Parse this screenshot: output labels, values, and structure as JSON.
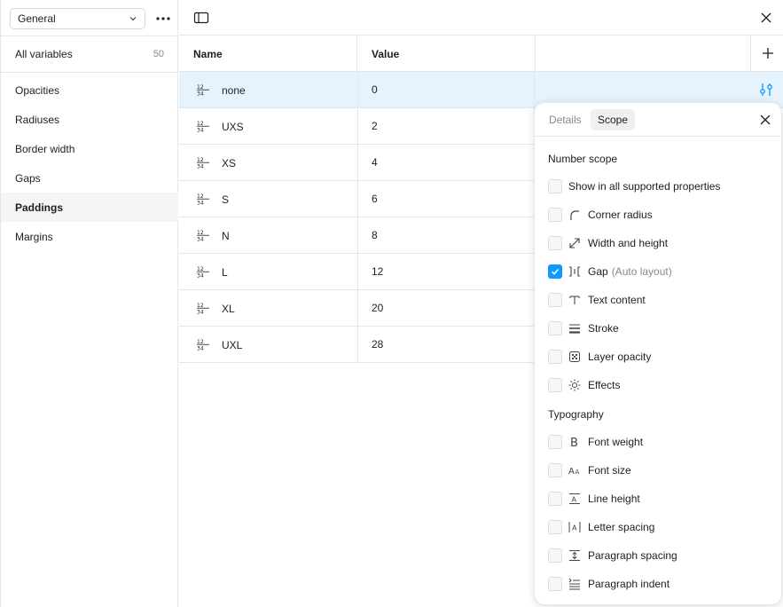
{
  "sidebar": {
    "collection": "General",
    "all_variables": {
      "label": "All variables",
      "count": "50"
    },
    "groups": [
      {
        "label": "Opacities",
        "active": false
      },
      {
        "label": "Radiuses",
        "active": false
      },
      {
        "label": "Border width",
        "active": false
      },
      {
        "label": "Gaps",
        "active": false
      },
      {
        "label": "Paddings",
        "active": true
      },
      {
        "label": "Margins",
        "active": false
      }
    ]
  },
  "table": {
    "headers": {
      "name": "Name",
      "value": "Value"
    },
    "rows": [
      {
        "name": "none",
        "value": "0",
        "selected": true
      },
      {
        "name": "UXS",
        "value": "2"
      },
      {
        "name": "XS",
        "value": "4"
      },
      {
        "name": "S",
        "value": "6"
      },
      {
        "name": "N",
        "value": "8"
      },
      {
        "name": "L",
        "value": "12"
      },
      {
        "name": "XL",
        "value": "20"
      },
      {
        "name": "UXL",
        "value": "28"
      }
    ]
  },
  "panel": {
    "tabs": {
      "details": "Details",
      "scope": "Scope"
    },
    "active_tab": "Scope",
    "number_scope_title": "Number scope",
    "typography_title": "Typography",
    "number_scope": [
      {
        "label": "Show in all supported properties",
        "checked": false,
        "icon": ""
      },
      {
        "label": "Corner radius",
        "checked": false,
        "icon": "corner-radius-icon"
      },
      {
        "label": "Width and height",
        "checked": false,
        "icon": "resize-icon"
      },
      {
        "label": "Gap",
        "sub": "(Auto layout)",
        "checked": true,
        "icon": "gap-icon"
      },
      {
        "label": "Text content",
        "checked": false,
        "icon": "text-icon"
      },
      {
        "label": "Stroke",
        "checked": false,
        "icon": "stroke-icon"
      },
      {
        "label": "Layer opacity",
        "checked": false,
        "icon": "opacity-icon"
      },
      {
        "label": "Effects",
        "checked": false,
        "icon": "effects-icon"
      }
    ],
    "typography": [
      {
        "label": "Font weight",
        "checked": false,
        "icon": "font-weight-icon"
      },
      {
        "label": "Font size",
        "checked": false,
        "icon": "font-size-icon"
      },
      {
        "label": "Line height",
        "checked": false,
        "icon": "line-height-icon"
      },
      {
        "label": "Letter spacing",
        "checked": false,
        "icon": "letter-spacing-icon"
      },
      {
        "label": "Paragraph spacing",
        "checked": false,
        "icon": "paragraph-spacing-icon"
      },
      {
        "label": "Paragraph indent",
        "checked": false,
        "icon": "paragraph-indent-icon"
      }
    ]
  },
  "colors": {
    "accent": "#0d99ff",
    "selected_row": "#e5f3fe",
    "border": "#e6e6e6"
  }
}
